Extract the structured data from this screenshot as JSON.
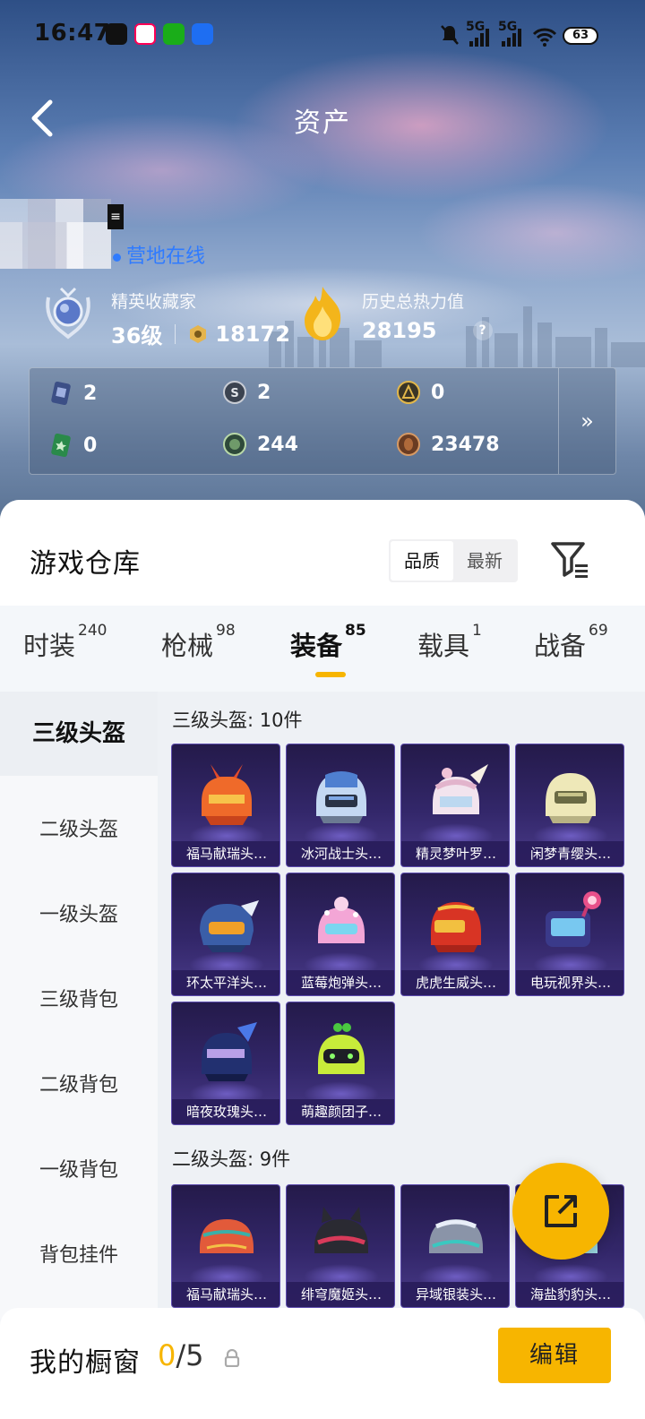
{
  "status_bar": {
    "time": "16:47",
    "signal_1": "5G",
    "signal_2": "5G",
    "battery": "63"
  },
  "header": {
    "title": "资产"
  },
  "profile": {
    "online_status": "营地在线",
    "elite": {
      "label": "精英收藏家",
      "level": "36级",
      "points": "18172"
    },
    "heat": {
      "label": "历史总热力值",
      "value": "28195",
      "help": "?"
    }
  },
  "currencies": {
    "row1": [
      "2",
      "2",
      "0"
    ],
    "row2": [
      "0",
      "244",
      "23478"
    ],
    "more": "»"
  },
  "warehouse": {
    "title": "游戏仓库",
    "sort_options": [
      "品质",
      "最新"
    ],
    "tabs": [
      {
        "label": "时装",
        "count": "240"
      },
      {
        "label": "枪械",
        "count": "98"
      },
      {
        "label": "装备",
        "count": "85"
      },
      {
        "label": "载具",
        "count": "1"
      },
      {
        "label": "战备",
        "count": "69"
      }
    ],
    "sidebar": [
      "三级头盔",
      "二级头盔",
      "一级头盔",
      "三级背包",
      "二级背包",
      "一级背包",
      "背包挂件"
    ],
    "groups": [
      {
        "title": "三级头盔: 10件",
        "items": [
          "福马献瑞头…",
          "冰河战士头…",
          "精灵梦叶罗…",
          "闲梦青缨头…",
          "环太平洋头…",
          "蓝莓炮弹头…",
          "虎虎生威头…",
          "电玩视界头…",
          "暗夜玫瑰头…",
          "萌趣颜团子…"
        ]
      },
      {
        "title": "二级头盔: 9件",
        "items": [
          "福马献瑞头…",
          "绯穹魔姬头…",
          "异域银装头…",
          "海盐豹豹头…"
        ]
      }
    ]
  },
  "showcase": {
    "title": "我的橱窗",
    "used": "0",
    "total": "/5",
    "edit_label": "编辑"
  }
}
